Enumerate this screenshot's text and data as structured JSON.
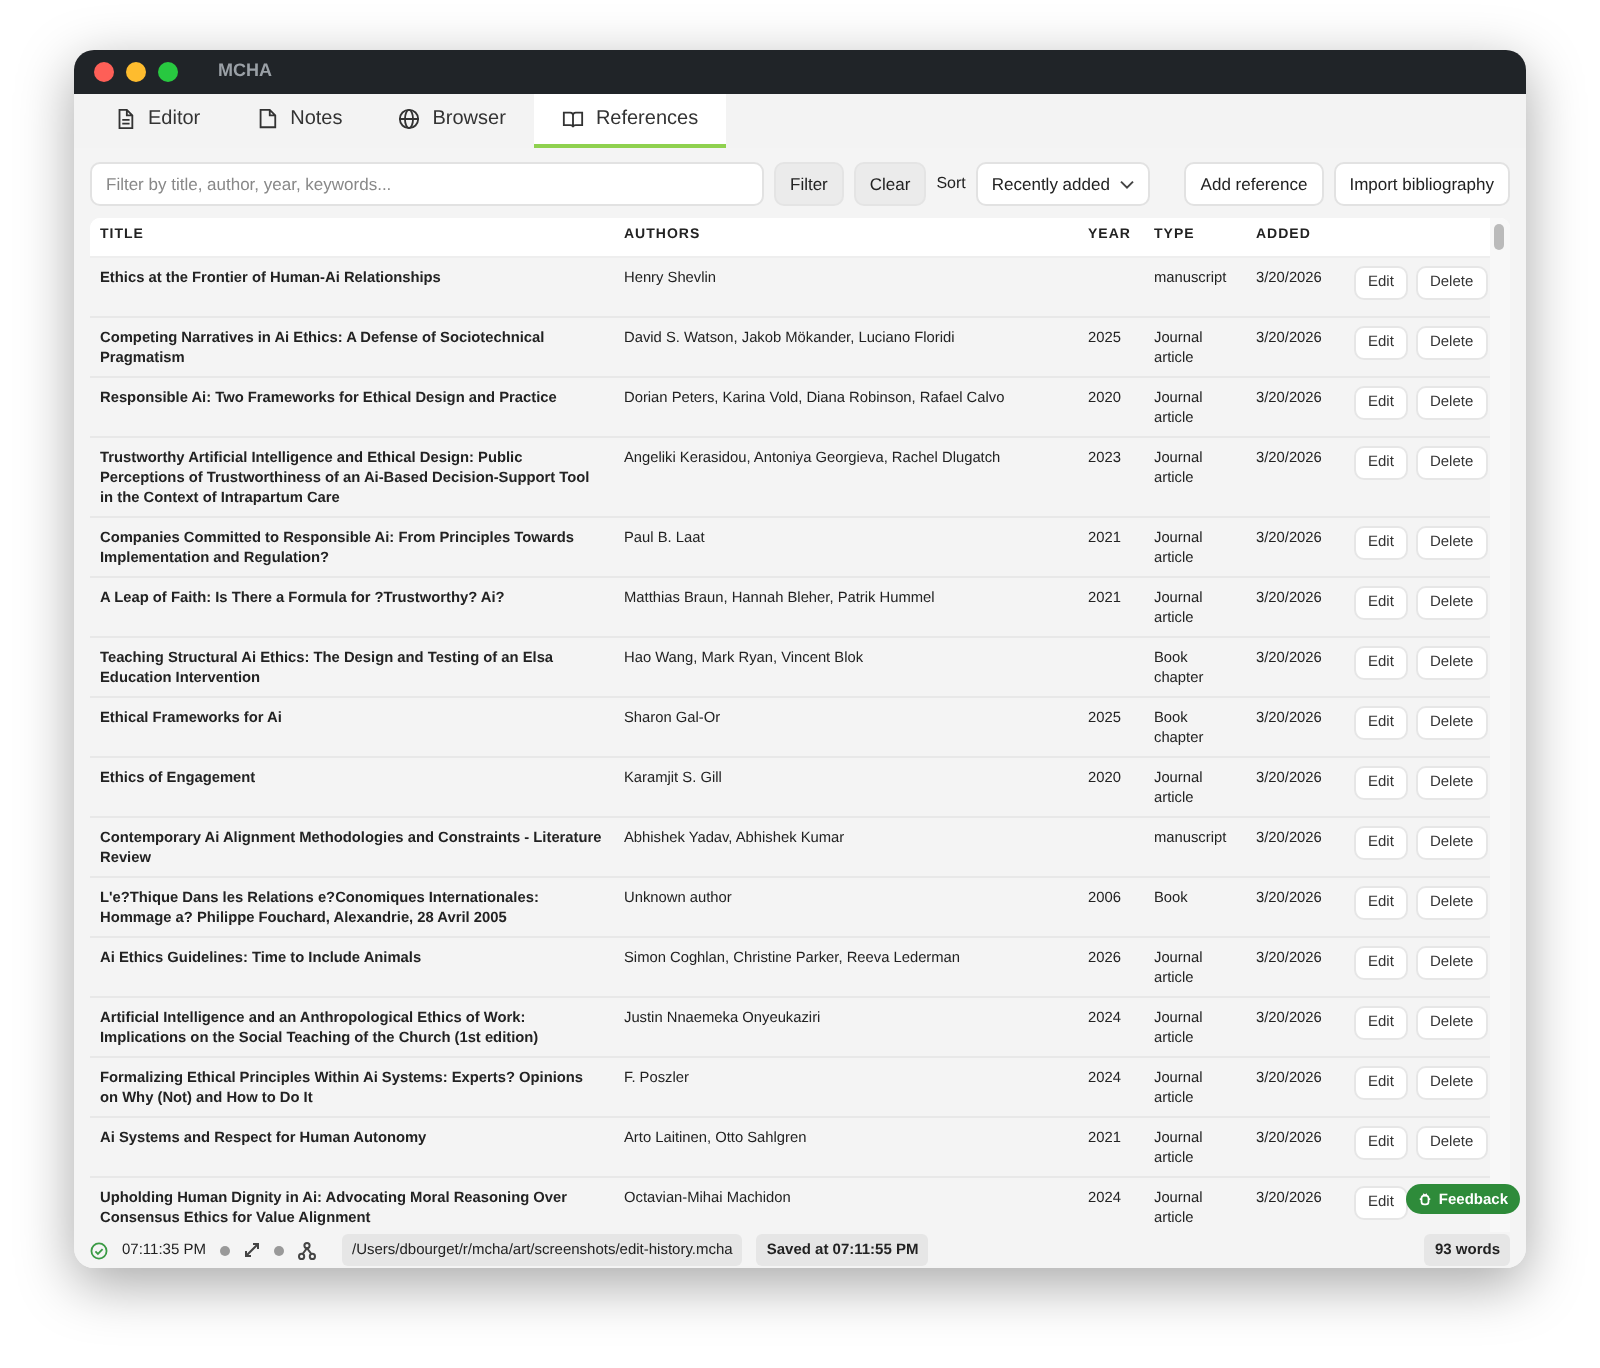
{
  "window": {
    "title": "MCHA"
  },
  "tabs": [
    {
      "label": "Editor",
      "selected": false
    },
    {
      "label": "Notes",
      "selected": false
    },
    {
      "label": "Browser",
      "selected": false
    },
    {
      "label": "References",
      "selected": true
    }
  ],
  "toolbar": {
    "search": {
      "placeholder": "Filter by title, author, year, keywords..."
    },
    "filter_button": "Filter",
    "clear_button": "Clear",
    "sort_label": "Sort",
    "sort_value": "Recently added",
    "add_button": "Add reference",
    "import_button": "Import bibliography"
  },
  "table": {
    "columns": [
      "TITLE",
      "AUTHORS",
      "YEAR",
      "TYPE",
      "ADDED"
    ],
    "rows": [
      {
        "title": "Ethics at the Frontier of Human-Ai Relationships",
        "authors": "Henry Shevlin",
        "type": "manuscript",
        "added": "3/20/2026",
        "actions": [
          "Edit",
          "Delete"
        ]
      },
      {
        "title": "Competing Narratives in Ai Ethics: A Defense of Sociotechnical Pragmatism",
        "authors": "David S. Watson, Jakob Mökander, Luciano Floridi",
        "year": "2025",
        "type": "Journal article",
        "added": "3/20/2026",
        "actions": [
          "Edit",
          "Delete"
        ]
      },
      {
        "title": "Responsible Ai: Two Frameworks for Ethical Design and Practice",
        "authors": "Dorian Peters, Karina Vold, Diana Robinson, Rafael Calvo",
        "year": "2020",
        "type": "Journal article",
        "added": "3/20/2026",
        "actions": [
          "Edit",
          "Delete"
        ]
      },
      {
        "title": "Trustworthy Artificial Intelligence and Ethical Design: Public Perceptions of Trustworthiness of an Ai-Based Decision-Support Tool in the Context of Intrapartum Care",
        "authors": "Angeliki Kerasidou, Antoniya Georgieva, Rachel Dlugatch",
        "year": "2023",
        "type": "Journal article",
        "added": "3/20/2026",
        "actions": [
          "Edit",
          "Delete"
        ]
      },
      {
        "title": "Companies Committed to Responsible Ai: From Principles Towards Implementation and Regulation?",
        "authors": "Paul B. Laat",
        "year": "2021",
        "type": "Journal article",
        "added": "3/20/2026",
        "actions": [
          "Edit",
          "Delete"
        ]
      },
      {
        "title": "A Leap of Faith: Is There a Formula for ?Trustworthy? Ai?",
        "authors": "Matthias Braun, Hannah Bleher, Patrik Hummel",
        "year": "2021",
        "type": "Journal article",
        "added": "3/20/2026",
        "actions": [
          "Edit",
          "Delete"
        ]
      },
      {
        "title": "Teaching Structural Ai Ethics: The Design and Testing of an Elsa Education Intervention",
        "authors": "Hao Wang, Mark Ryan, Vincent Blok",
        "type": "Book chapter",
        "added": "3/20/2026",
        "actions": [
          "Edit",
          "Delete"
        ]
      },
      {
        "title": "Ethical Frameworks for Ai",
        "authors": "Sharon Gal-Or",
        "year": "2025",
        "type": "Book chapter",
        "added": "3/20/2026",
        "actions": [
          "Edit",
          "Delete"
        ]
      },
      {
        "title": "Ethics of Engagement",
        "authors": "Karamjit S. Gill",
        "year": "2020",
        "type": "Journal article",
        "added": "3/20/2026",
        "actions": [
          "Edit",
          "Delete"
        ]
      },
      {
        "title": "Contemporary Ai Alignment Methodologies and Constraints - Literature Review",
        "authors": "Abhishek Yadav, Abhishek Kumar",
        "type": "manuscript",
        "added": "3/20/2026",
        "actions": [
          "Edit",
          "Delete"
        ]
      },
      {
        "title": "L'e?Thique Dans les Relations e?Conomiques Internationales: Hommage a? Philippe Fouchard, Alexandrie, 28 Avril 2005",
        "authors": "Unknown author",
        "year": "2006",
        "type": "Book",
        "added": "3/20/2026",
        "actions": [
          "Edit",
          "Delete"
        ]
      },
      {
        "title": "Ai Ethics Guidelines: Time to Include Animals",
        "authors": "Simon Coghlan, Christine Parker, Reeva Lederman",
        "year": "2026",
        "type": "Journal article",
        "added": "3/20/2026",
        "actions": [
          "Edit",
          "Delete"
        ]
      },
      {
        "title": "Artificial Intelligence and an Anthropological Ethics of Work: Implications on the Social Teaching of the Church (1st edition)",
        "authors": "Justin Nnaemeka Onyeukaziri",
        "year": "2024",
        "type": "Journal article",
        "added": "3/20/2026",
        "actions": [
          "Edit",
          "Delete"
        ]
      },
      {
        "title": "Formalizing Ethical Principles Within Ai Systems: Experts? Opinions on Why (Not) and How to Do It",
        "authors": "F. Poszler",
        "year": "2024",
        "type": "Journal article",
        "added": "3/20/2026",
        "actions": [
          "Edit",
          "Delete"
        ]
      },
      {
        "title": "Ai Systems and Respect for Human Autonomy",
        "authors": "Arto Laitinen, Otto Sahlgren",
        "year": "2021",
        "type": "Journal article",
        "added": "3/20/2026",
        "actions": [
          "Edit",
          "Delete"
        ]
      },
      {
        "title": "Upholding Human Dignity in Ai: Advocating Moral Reasoning Over Consensus Ethics for Value Alignment",
        "authors": "Octavian-Mihai Machidon",
        "year": "2024",
        "type": "Journal article",
        "added": "3/20/2026",
        "actions": [
          "Edit"
        ]
      }
    ]
  },
  "feedback_button": "Feedback",
  "status_bar": {
    "time": "07:11:35 PM",
    "path": "/Users/dbourget/r/mcha/art/screenshots/edit-history.mcha",
    "saved": "Saved at 07:11:55 PM",
    "words": "93 words"
  }
}
